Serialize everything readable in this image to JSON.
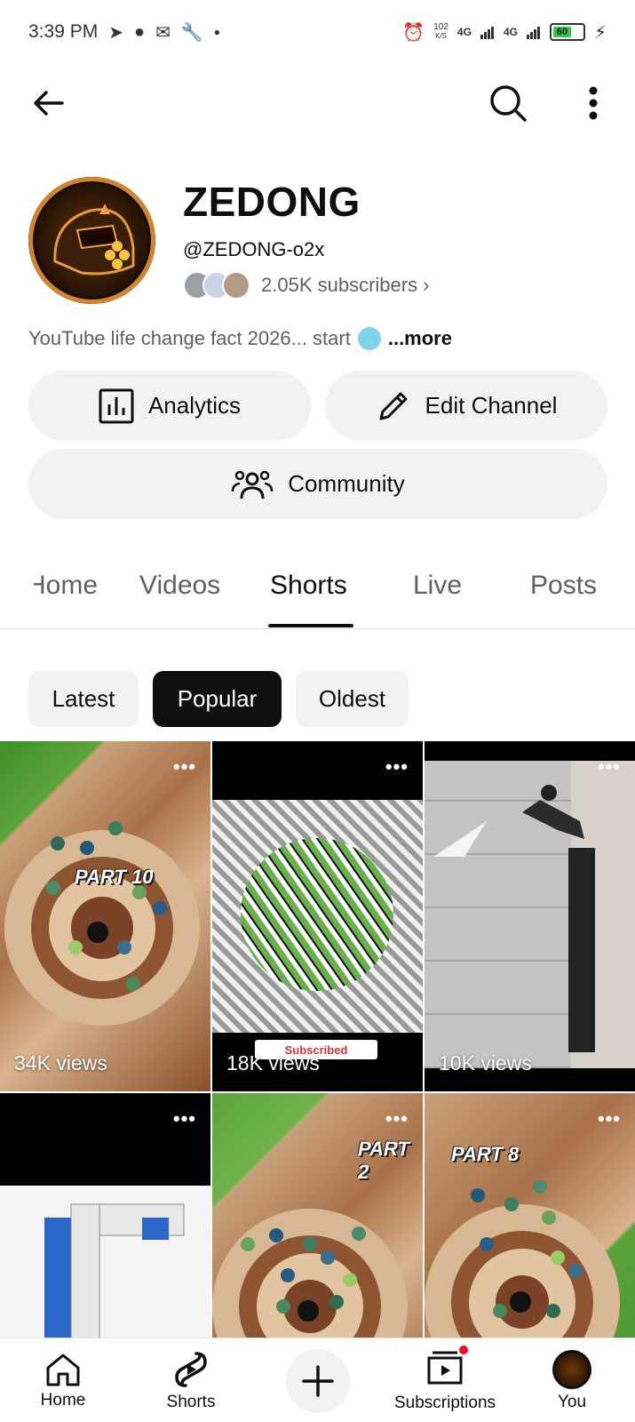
{
  "status_bar": {
    "time": "3:39 PM",
    "speed_value": "102",
    "speed_unit": "K/S",
    "network_1": "4G",
    "network_2": "4G",
    "battery": "60"
  },
  "channel": {
    "name": "ZEDONG",
    "handle": "@ZEDONG-o2x",
    "subscribers": "2.05K subscribers",
    "description": "YouTube life change fact 2026... start",
    "more_label": "...more"
  },
  "actions": {
    "analytics_label": "Analytics",
    "edit_label": "Edit Channel",
    "community_label": "Community"
  },
  "tabs": [
    {
      "label": "Home"
    },
    {
      "label": "Videos"
    },
    {
      "label": "Shorts"
    },
    {
      "label": "Live"
    },
    {
      "label": "Posts"
    }
  ],
  "active_tab": "Shorts",
  "chips": [
    {
      "label": "Latest"
    },
    {
      "label": "Popular"
    },
    {
      "label": "Oldest"
    }
  ],
  "active_chip": "Popular",
  "shorts": [
    {
      "views": "34K views",
      "overlay_text": "PART 10",
      "menu": "•••"
    },
    {
      "views": "18K views",
      "overlay_text": "Subscribed",
      "menu": "•••"
    },
    {
      "views": "10K views",
      "overlay_text": "",
      "menu": "•••"
    },
    {
      "views": "",
      "overlay_text": "",
      "menu": "•••"
    },
    {
      "views": "",
      "overlay_text": "PART 2",
      "menu": "•••"
    },
    {
      "views": "",
      "overlay_text": "PART 8",
      "menu": "•••"
    }
  ],
  "bottom_nav": {
    "home": "Home",
    "shorts": "Shorts",
    "subscriptions": "Subscriptions",
    "you": "You"
  },
  "colors": {
    "accent": "#0f0f0f",
    "chip_bg": "#f2f2f2",
    "notification": "#ff0033"
  }
}
